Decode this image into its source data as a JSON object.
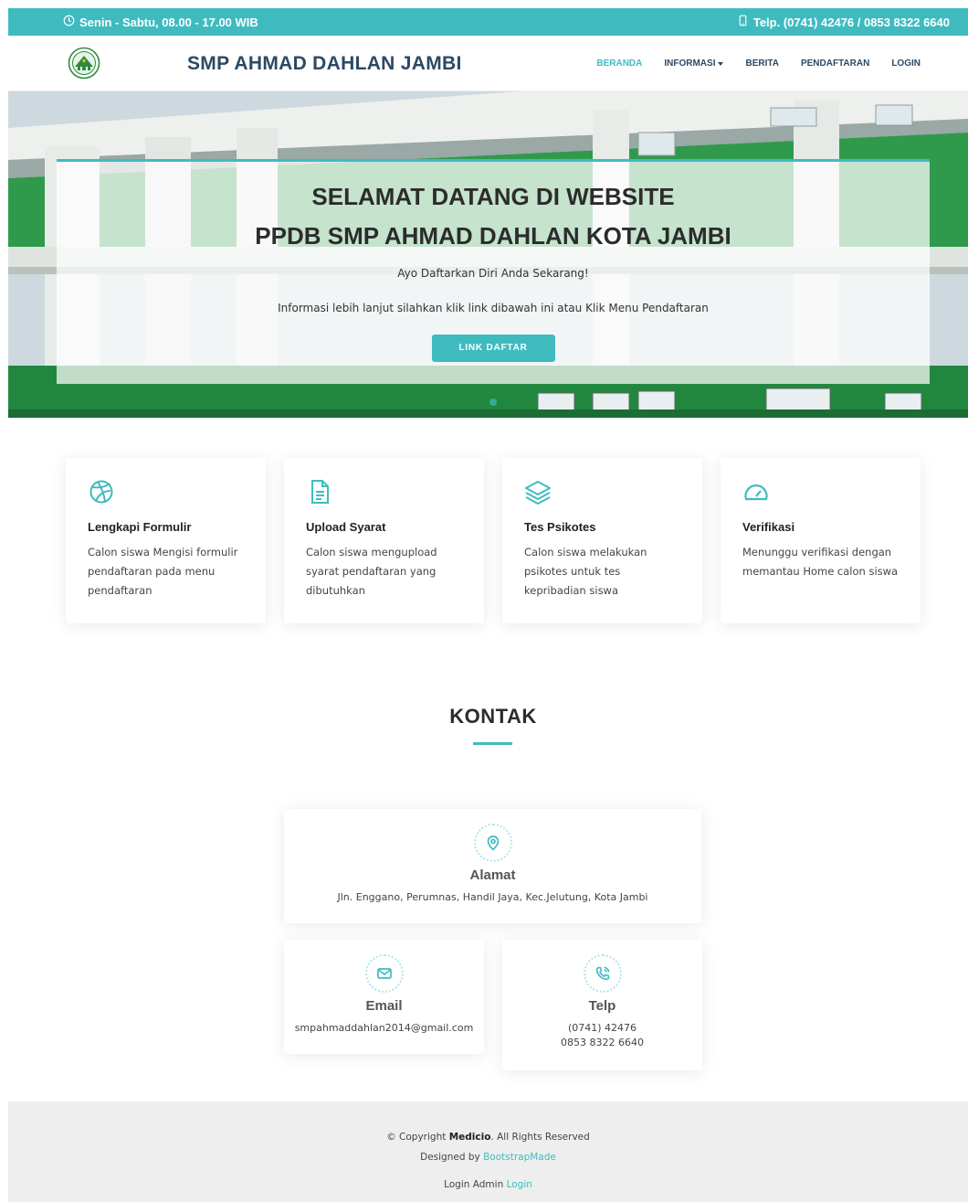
{
  "topbar": {
    "hours": "Senin - Sabtu, 08.00 - 17.00 WIB",
    "phone": "Telp. (0741) 42476 / 0853 8322 6640",
    "hours_icon": "clock-icon",
    "phone_icon": "phone-icon"
  },
  "header": {
    "site_title": "SMP AHMAD DAHLAN JAMBI",
    "logo_icon": "school-logo-icon",
    "nav": {
      "beranda": "BERANDA",
      "informasi": "INFORMASI",
      "berita": "BERITA",
      "pendaftaran": "PENDAFTARAN",
      "login": "LOGIN"
    }
  },
  "hero": {
    "title_line1": "SELAMAT DATANG DI WEBSITE",
    "title_line2": "PPDB SMP AHMAD DAHLAN KOTA JAMBI",
    "subtitle": "Ayo Daftarkan Diri Anda Sekarang!",
    "description": "Informasi lebih lanjut silahkan klik link dibawah ini atau Klik Menu Pendaftaran",
    "button": "LINK DAFTAR"
  },
  "features": [
    {
      "icon": "dribbble-icon",
      "title": "Lengkapi Formulir",
      "text": "Calon siswa Mengisi formulir pendaftaran pada menu pendaftaran"
    },
    {
      "icon": "file-text-icon",
      "title": "Upload Syarat",
      "text": "Calon siswa mengupload syarat pendaftaran yang dibutuhkan"
    },
    {
      "icon": "layers-icon",
      "title": "Tes Psikotes",
      "text": "Calon siswa melakukan psikotes untuk tes kepribadian siswa"
    },
    {
      "icon": "speedometer-icon",
      "title": "Verifikasi",
      "text": "Menunggu verifikasi dengan memantau Home calon siswa"
    }
  ],
  "kontak": {
    "title": "KONTAK",
    "alamat": {
      "icon": "map-pin-icon",
      "title": "Alamat",
      "text": "Jln. Enggano, Perumnas, Handil Jaya, Kec.Jelutung, Kota Jambi"
    },
    "email": {
      "icon": "envelope-icon",
      "title": "Email",
      "text": "smpahmaddahlan2014@gmail.com"
    },
    "telp": {
      "icon": "phone-call-icon",
      "title": "Telp",
      "line1": "(0741) 42476",
      "line2": "0853 8322 6640"
    }
  },
  "footer": {
    "copyright_prefix": "© Copyright",
    "brand": "Medicio",
    "copyright_suffix": ". All Rights Reserved",
    "designed_prefix": "Designed by",
    "designed_link": "BootstrapMade",
    "login_prefix": "Login Admin",
    "login_link": "Login"
  },
  "colors": {
    "accent": "#3fbbc0",
    "heading": "#2c4964",
    "footer_bg": "#eeeeee"
  }
}
